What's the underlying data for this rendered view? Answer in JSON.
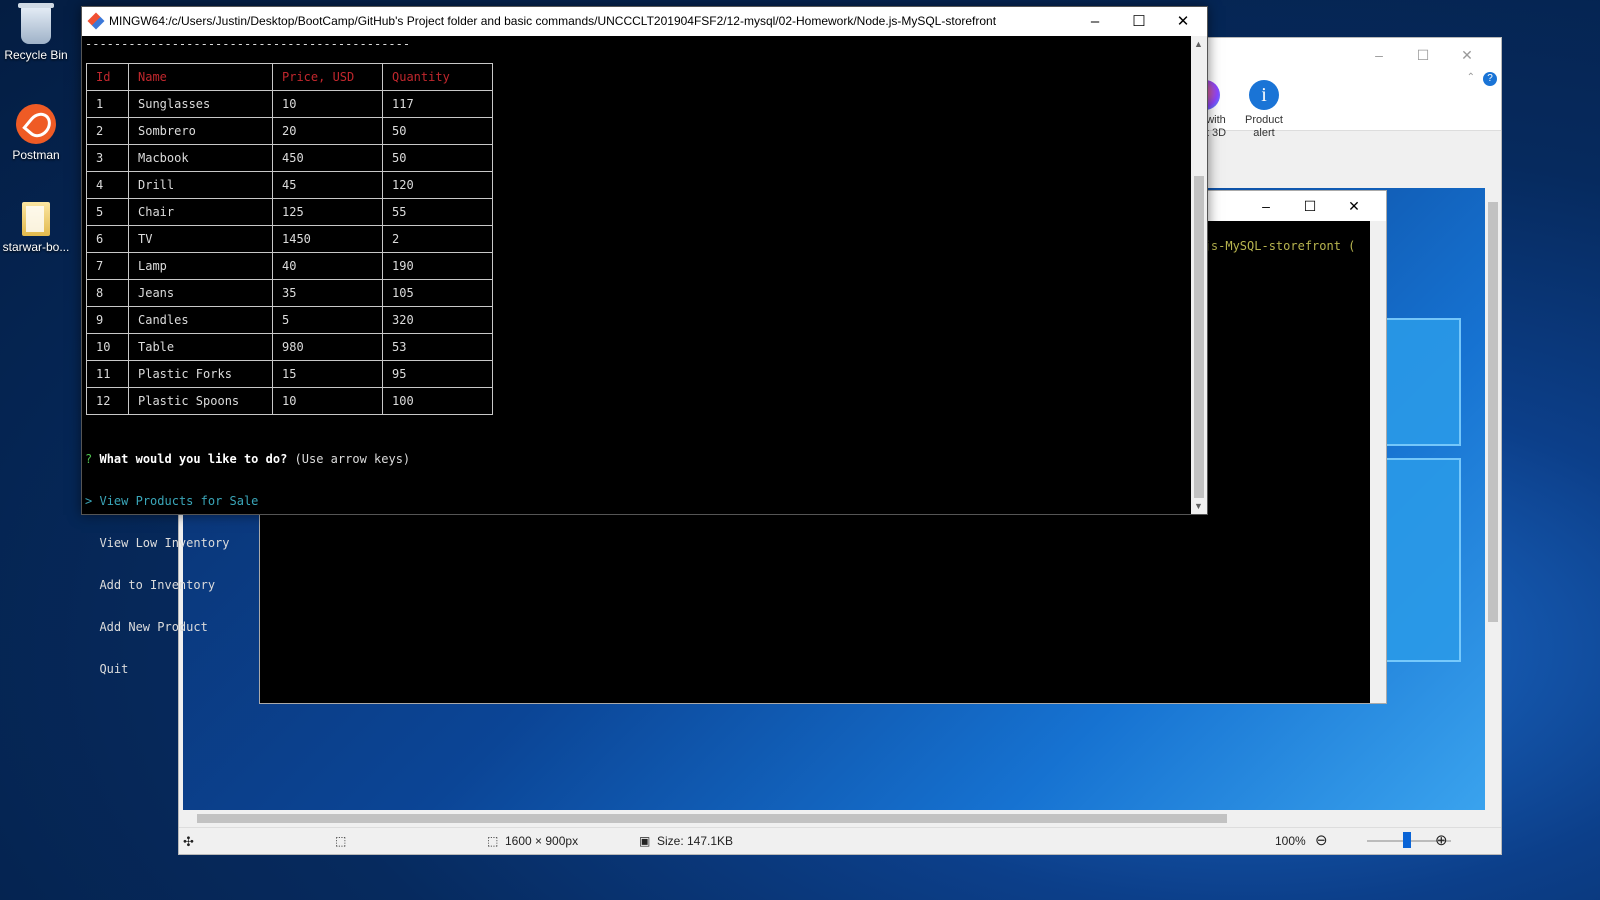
{
  "desktop": {
    "icons": [
      {
        "label": "Recycle Bin"
      },
      {
        "label": "Postman"
      },
      {
        "label": "starwar-bo..."
      }
    ]
  },
  "viewer": {
    "ribbon": {
      "edit_paint3d": "Edit with Paint 3D",
      "product_alert": "Product alert"
    },
    "status": {
      "dimensions": "1600 × 900px",
      "size": "Size: 147.1KB",
      "zoom": "100%"
    }
  },
  "term2": {
    "path_fragment": "de.js-MySQL-storefront ("
  },
  "terminal": {
    "title": "MINGW64:/c/Users/Justin/Desktop/BootCamp/GitHub's Project folder and basic commands/UNCCCLT201904FSF2/12-mysql/02-Homework/Node.js-MySQL-storefront",
    "divider": "---------------------------------------------",
    "table": {
      "headers": [
        "Id",
        "Name",
        "Price, USD",
        "Quantity"
      ],
      "rows": [
        [
          "1",
          "Sunglasses",
          "10",
          "117"
        ],
        [
          "2",
          "Sombrero",
          "20",
          "50"
        ],
        [
          "3",
          "Macbook",
          "450",
          "50"
        ],
        [
          "4",
          "Drill",
          "45",
          "120"
        ],
        [
          "5",
          "Chair",
          "125",
          "55"
        ],
        [
          "6",
          "TV",
          "1450",
          "2"
        ],
        [
          "7",
          "Lamp",
          "40",
          "190"
        ],
        [
          "8",
          "Jeans",
          "35",
          "105"
        ],
        [
          "9",
          "Candles",
          "5",
          "320"
        ],
        [
          "10",
          "Table",
          "980",
          "53"
        ],
        [
          "11",
          "Plastic Forks",
          "15",
          "95"
        ],
        [
          "12",
          "Plastic Spoons",
          "10",
          "100"
        ]
      ]
    },
    "prompt": {
      "marker": "?",
      "question": "What would you like to do?",
      "hint": "(Use arrow keys)",
      "pointer": ">",
      "options": [
        "View Products for Sale",
        "View Low Inventory",
        "Add to Inventory",
        "Add New Product",
        "Quit"
      ]
    }
  },
  "controls": {
    "minimize": "–",
    "maximize": "☐",
    "close": "✕"
  }
}
